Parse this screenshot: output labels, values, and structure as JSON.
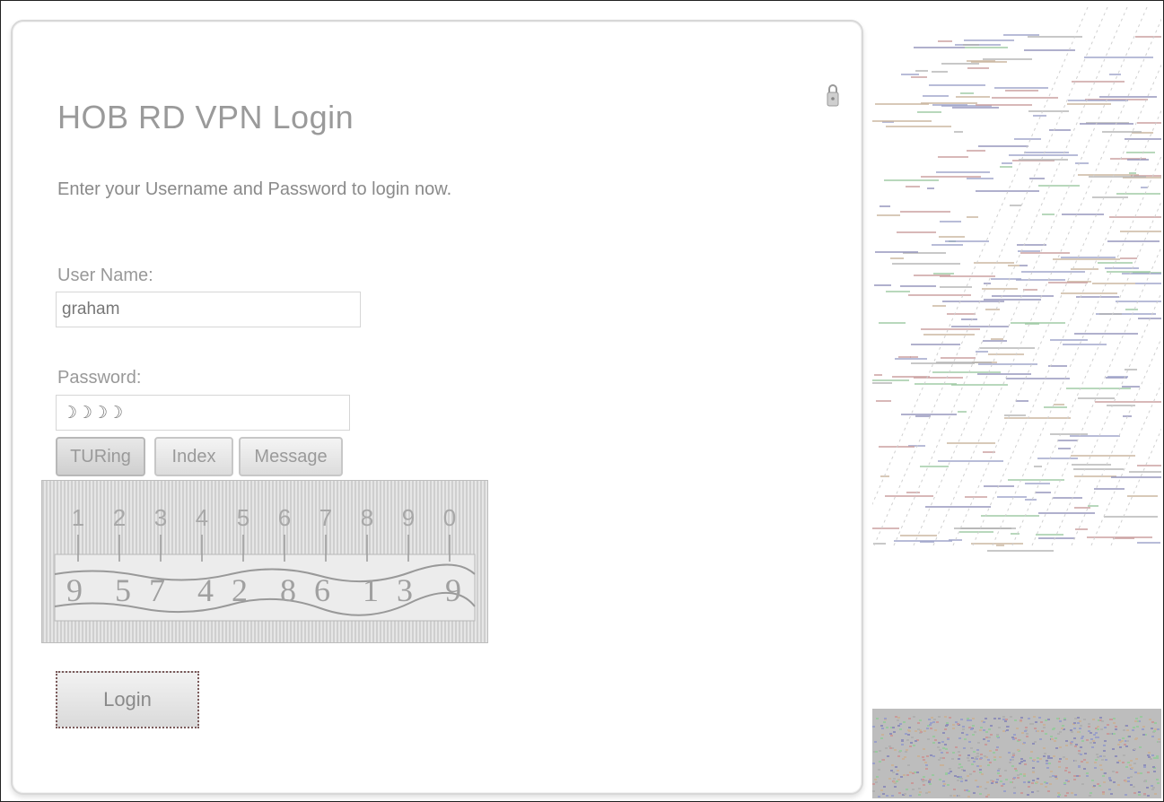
{
  "login": {
    "title": "HOB RD VPN Login",
    "subtitle": "Enter your Username and Password to login now.",
    "username_label": "User Name:",
    "username_value": "graham",
    "password_label": "Password:",
    "password_value": "☽☽☽☽",
    "tabs": [
      {
        "label": "TURing",
        "active": true
      },
      {
        "label": "Index",
        "active": false
      },
      {
        "label": "Message",
        "active": false
      }
    ],
    "captcha": {
      "top_digits": [
        "1",
        "2",
        "3",
        "4",
        "5",
        "6",
        "7",
        "8",
        "9",
        "0"
      ],
      "bottom_digits": [
        "9",
        "5",
        "7",
        "4",
        "2",
        "8",
        "6",
        "1",
        "3",
        "9"
      ]
    },
    "login_button": "Login"
  },
  "icons": {
    "lock": "lock-icon"
  },
  "colors": {
    "text": "#9a9a9a",
    "panel_border": "#d8d8d8"
  }
}
